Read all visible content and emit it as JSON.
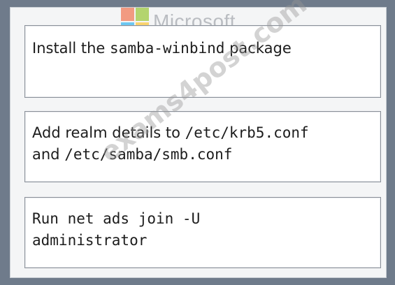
{
  "logo": {
    "word": "Microsoft",
    "colors": [
      "#f25022",
      "#7fba00",
      "#00a4ef",
      "#ffb900"
    ]
  },
  "watermark": "exams4post.com",
  "steps": [
    {
      "parts": [
        {
          "text": "Install the ",
          "mono": false
        },
        {
          "text": "samba-winbind",
          "mono": true
        },
        {
          "text": " package",
          "mono": false
        }
      ]
    },
    {
      "lines": [
        [
          {
            "text": "Add realm details to ",
            "mono": false
          },
          {
            "text": "/etc/krb5.conf",
            "mono": true
          }
        ],
        [
          {
            "text": "and ",
            "mono": false
          },
          {
            "text": "/etc/samba/smb.conf",
            "mono": true
          }
        ]
      ]
    },
    {
      "lines": [
        [
          {
            "text": "Run net ads join -U",
            "mono": true
          }
        ],
        [
          {
            "text": "administrator",
            "mono": true
          }
        ]
      ]
    }
  ]
}
